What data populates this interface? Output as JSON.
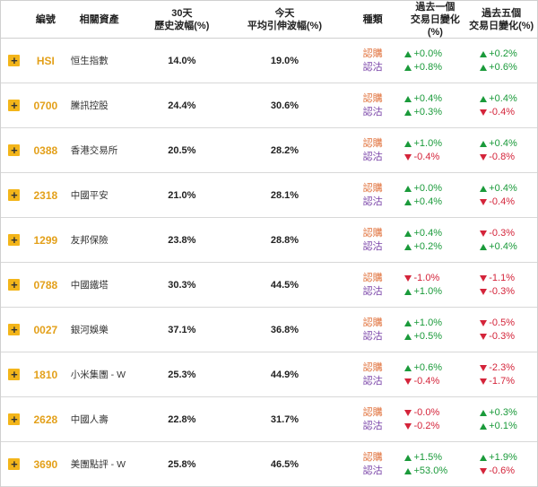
{
  "header": {
    "code": "編號",
    "asset": "相關資產",
    "hv_line1": "30天",
    "hv_line2": "歷史波幅(%)",
    "iv_line1": "今天",
    "iv_line2": "平均引伸波幅(%)",
    "type": "種類",
    "d1_line1": "過去一個",
    "d1_line2": "交易日變化(%)",
    "d5_line1": "過去五個",
    "d5_line2": "交易日變化(%)"
  },
  "icons": {
    "expand": "plus-icon",
    "up": "triangle-up-icon",
    "down": "triangle-down-icon"
  },
  "colors": {
    "code": "#e3a01a",
    "call": "#e0703a",
    "put": "#7a44a8",
    "up": "#1a9a3a",
    "down": "#d4243a",
    "plus_bg": "#f3b51a"
  },
  "labels": {
    "call": "認購",
    "put": "認沽",
    "plus": "+"
  },
  "rows": [
    {
      "code": "HSI",
      "name": "恒生指數",
      "hv": "14.0%",
      "iv": "19.0%",
      "d1": [
        {
          "dir": "up",
          "val": "+0.0%"
        },
        {
          "dir": "up",
          "val": "+0.8%"
        }
      ],
      "d5": [
        {
          "dir": "up",
          "val": "+0.2%"
        },
        {
          "dir": "up",
          "val": "+0.6%"
        }
      ]
    },
    {
      "code": "0700",
      "name": "騰訊控股",
      "hv": "24.4%",
      "iv": "30.6%",
      "d1": [
        {
          "dir": "up",
          "val": "+0.4%"
        },
        {
          "dir": "up",
          "val": "+0.3%"
        }
      ],
      "d5": [
        {
          "dir": "up",
          "val": "+0.4%"
        },
        {
          "dir": "down",
          "val": "-0.4%"
        }
      ]
    },
    {
      "code": "0388",
      "name": "香港交易所",
      "hv": "20.5%",
      "iv": "28.2%",
      "d1": [
        {
          "dir": "up",
          "val": "+1.0%"
        },
        {
          "dir": "down",
          "val": "-0.4%"
        }
      ],
      "d5": [
        {
          "dir": "up",
          "val": "+0.4%"
        },
        {
          "dir": "down",
          "val": "-0.8%"
        }
      ]
    },
    {
      "code": "2318",
      "name": "中國平安",
      "hv": "21.0%",
      "iv": "28.1%",
      "d1": [
        {
          "dir": "up",
          "val": "+0.0%"
        },
        {
          "dir": "up",
          "val": "+0.4%"
        }
      ],
      "d5": [
        {
          "dir": "up",
          "val": "+0.4%"
        },
        {
          "dir": "down",
          "val": "-0.4%"
        }
      ]
    },
    {
      "code": "1299",
      "name": "友邦保險",
      "hv": "23.8%",
      "iv": "28.8%",
      "d1": [
        {
          "dir": "up",
          "val": "+0.4%"
        },
        {
          "dir": "up",
          "val": "+0.2%"
        }
      ],
      "d5": [
        {
          "dir": "down",
          "val": "-0.3%"
        },
        {
          "dir": "up",
          "val": "+0.4%"
        }
      ]
    },
    {
      "code": "0788",
      "name": "中國鐵塔",
      "hv": "30.3%",
      "iv": "44.5%",
      "d1": [
        {
          "dir": "down",
          "val": "-1.0%"
        },
        {
          "dir": "up",
          "val": "+1.0%"
        }
      ],
      "d5": [
        {
          "dir": "down",
          "val": "-1.1%"
        },
        {
          "dir": "down",
          "val": "-0.3%"
        }
      ]
    },
    {
      "code": "0027",
      "name": "銀河娛樂",
      "hv": "37.1%",
      "iv": "36.8%",
      "d1": [
        {
          "dir": "up",
          "val": "+1.0%"
        },
        {
          "dir": "up",
          "val": "+0.5%"
        }
      ],
      "d5": [
        {
          "dir": "down",
          "val": "-0.5%"
        },
        {
          "dir": "down",
          "val": "-0.3%"
        }
      ]
    },
    {
      "code": "1810",
      "name": "小米集團 - W",
      "hv": "25.3%",
      "iv": "44.9%",
      "d1": [
        {
          "dir": "up",
          "val": "+0.6%"
        },
        {
          "dir": "down",
          "val": "-0.4%"
        }
      ],
      "d5": [
        {
          "dir": "down",
          "val": "-2.3%"
        },
        {
          "dir": "down",
          "val": "-1.7%"
        }
      ]
    },
    {
      "code": "2628",
      "name": "中國人壽",
      "hv": "22.8%",
      "iv": "31.7%",
      "d1": [
        {
          "dir": "down",
          "val": "-0.0%"
        },
        {
          "dir": "down",
          "val": "-0.2%"
        }
      ],
      "d5": [
        {
          "dir": "up",
          "val": "+0.3%"
        },
        {
          "dir": "up",
          "val": "+0.1%"
        }
      ]
    },
    {
      "code": "3690",
      "name": "美團點評 - W",
      "hv": "25.8%",
      "iv": "46.5%",
      "d1": [
        {
          "dir": "up",
          "val": "+1.5%"
        },
        {
          "dir": "up",
          "val": "+53.0%"
        }
      ],
      "d5": [
        {
          "dir": "up",
          "val": "+1.9%"
        },
        {
          "dir": "down",
          "val": "-0.6%"
        }
      ]
    }
  ]
}
